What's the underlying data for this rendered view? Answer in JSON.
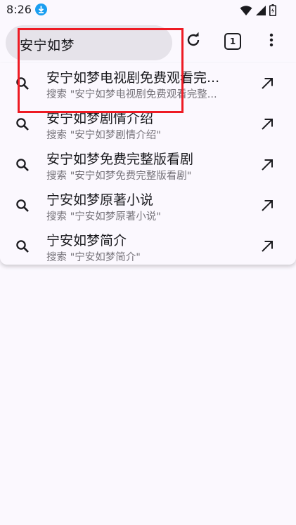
{
  "status": {
    "time": "8:26"
  },
  "omnibox": {
    "query": "安宁如梦"
  },
  "toolbar": {
    "tab_count": "1"
  },
  "suggestions": [
    {
      "title": "安宁如梦电视剧免费观看完...",
      "subtitle": "搜索 \"安宁如梦电视剧免费观看完整..."
    },
    {
      "title": "安宁如梦剧情介绍",
      "subtitle": "搜索 \"安宁如梦剧情介绍\""
    },
    {
      "title": "安宁如梦免费完整版看剧",
      "subtitle": "搜索 \"安宁如梦免费完整版看剧\""
    },
    {
      "title": "宁安如梦原著小说",
      "subtitle": "搜索 \"宁安如梦原著小说\""
    },
    {
      "title": "宁安如梦简介",
      "subtitle": "搜索 \"宁安如梦简介\""
    }
  ],
  "colors": {
    "highlight": "#ee1b24",
    "download_badge": "#1a9ef0",
    "background": "#fbf8fe"
  }
}
